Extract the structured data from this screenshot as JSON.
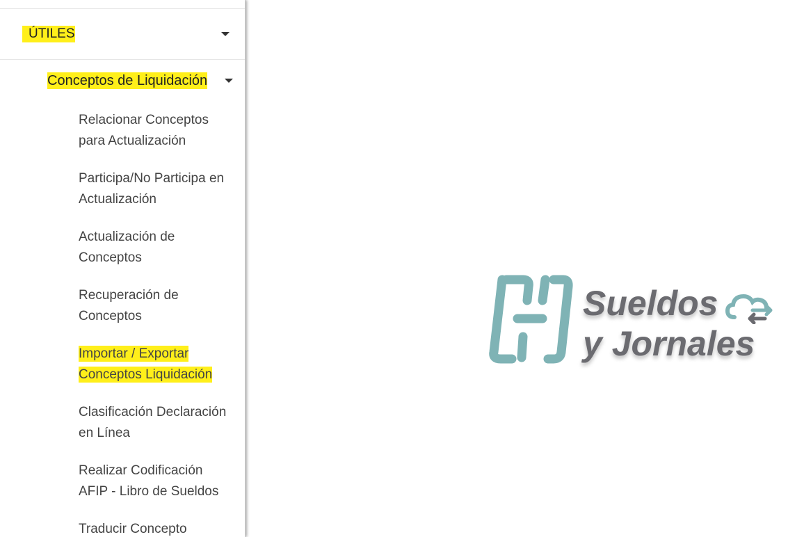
{
  "sidebar": {
    "section": {
      "label": "ÚTILES",
      "expanded": true
    },
    "group": {
      "label": "Conceptos de Liquidación",
      "expanded": true
    },
    "items": [
      {
        "line1": "Relacionar Conceptos",
        "line2": "para Actualización",
        "highlighted": false
      },
      {
        "line1": "Participa/No Participa en",
        "line2": "Actualización",
        "highlighted": false
      },
      {
        "line1": "Actualización de",
        "line2": "Conceptos",
        "highlighted": false
      },
      {
        "line1": "Recuperación de",
        "line2": "Conceptos",
        "highlighted": false
      },
      {
        "line1": "Importar / Exportar",
        "line2": "Conceptos Liquidación",
        "highlighted": true
      },
      {
        "line1": "Clasificación Declaración",
        "line2": "en Línea",
        "highlighted": false
      },
      {
        "line1": "Realizar Codificación",
        "line2": "AFIP - Libro de Sueldos",
        "highlighted": false
      },
      {
        "line1": "Traducir Concepto",
        "line2": "",
        "highlighted": false
      }
    ]
  },
  "logo": {
    "line1": "Sueldos",
    "line2": "y Jornales",
    "icon_color": "#7fb3b5",
    "text_color": "#6b6b70"
  },
  "colors": {
    "highlight": "#ffef1a",
    "text": "#444444"
  }
}
